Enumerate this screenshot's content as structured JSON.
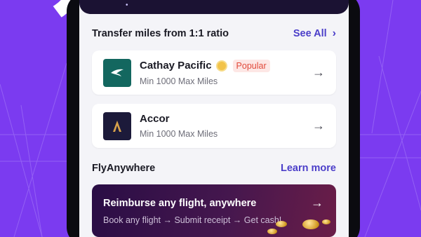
{
  "transfer": {
    "title": "Transfer miles from 1:1 ratio",
    "see_all_label": "See All",
    "partners": [
      {
        "name": "Cathay Pacific",
        "badge": "Popular",
        "subtitle": "Min 1000 Max Miles",
        "logo_color": "#13675f",
        "icon": "cathay-logo-icon"
      },
      {
        "name": "Accor",
        "badge": "",
        "subtitle": "Min 1000 Max Miles",
        "logo_color": "#1c1a3a",
        "icon": "accor-logo-icon"
      }
    ]
  },
  "fly_anywhere": {
    "title": "FlyAnywhere",
    "learn_more_label": "Learn more",
    "promo": {
      "title": "Reimburse any flight, anywhere",
      "subtitle": "Book any flight → Submit receipt → Get cash!"
    }
  },
  "colors": {
    "background": "#7b3bf0",
    "accent": "#4b3ec9",
    "popular_text": "#e14a3b",
    "popular_bg": "#fde7e5"
  }
}
